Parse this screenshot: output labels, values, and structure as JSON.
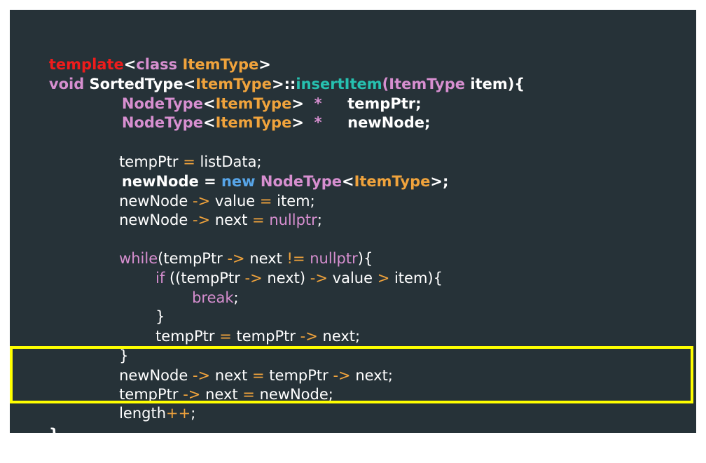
{
  "code": {
    "l1": {
      "t1": "template",
      "t2": "<",
      "t3": "class",
      "t4": " ",
      "t5": "ItemType",
      "t6": ">"
    },
    "l2": {
      "t1": "void ",
      "t2": "SortedType",
      "t3": "<",
      "t4": "ItemType",
      "t5": ">::",
      "t6": "insertItem",
      "t7": "(",
      "t8": "ItemType",
      "t9": " item){"
    },
    "l3": {
      "t1": "NodeType",
      "t2": "<",
      "t3": "ItemType",
      "t4": ">",
      "t5": "  *",
      "t6": "     tempPtr;"
    },
    "l4": {
      "t1": "NodeType",
      "t2": "<",
      "t3": "ItemType",
      "t4": ">",
      "t5": "  *",
      "t6": "     newNode;"
    },
    "l5": {
      "t1": "tempPtr ",
      "t2": "=",
      "t3": " listData;"
    },
    "l6": {
      "t1": "newNode ",
      "t2": "=",
      "t3": " ",
      "t4": "new",
      "t5": " ",
      "t6": "NodeType",
      "t7": "<",
      "t8": "ItemType",
      "t9": ">;"
    },
    "l7": {
      "t1": "newNode ",
      "t2": "->",
      "t3": " value ",
      "t4": "=",
      "t5": " item;"
    },
    "l8": {
      "t1": "newNode ",
      "t2": "->",
      "t3": " next ",
      "t4": "=",
      "t5": " ",
      "t6": "nullptr",
      "t7": ";"
    },
    "l9": {
      "t1": "while",
      "t2": "(tempPtr ",
      "t3": "->",
      "t4": " next ",
      "t5": "!=",
      "t6": " ",
      "t7": "nullptr",
      "t8": "){"
    },
    "l10": {
      "t1": "if",
      "t2": " ((tempPtr ",
      "t3": "->",
      "t4": " next) ",
      "t5": "->",
      "t6": " value ",
      "t7": ">",
      "t8": " item){"
    },
    "l11": {
      "t1": "break",
      "t2": ";"
    },
    "l12": {
      "t1": "}"
    },
    "l13": {
      "t1": "tempPtr ",
      "t2": "=",
      "t3": " tempPtr ",
      "t4": "->",
      "t5": " next;"
    },
    "l14": {
      "t1": "}"
    },
    "l15": {
      "t1": "newNode ",
      "t2": "->",
      "t3": " next ",
      "t4": "=",
      "t5": " tempPtr ",
      "t6": "->",
      "t7": " next;"
    },
    "l16": {
      "t1": "tempPtr ",
      "t2": "->",
      "t3": " next ",
      "t4": "=",
      "t5": " newNode;"
    },
    "l17": {
      "t1": "length",
      "t2": "++",
      "t3": ";"
    },
    "l18": {
      "t1": "}"
    }
  },
  "colors": {
    "background": "#263238",
    "keyword_red": "#ee1c1c",
    "keyword_pink": "#d78fd0",
    "type_orange": "#f0a33c",
    "function_teal": "#26c1b0",
    "new_blue": "#57a5e8",
    "highlight_yellow": "#ffff00"
  }
}
